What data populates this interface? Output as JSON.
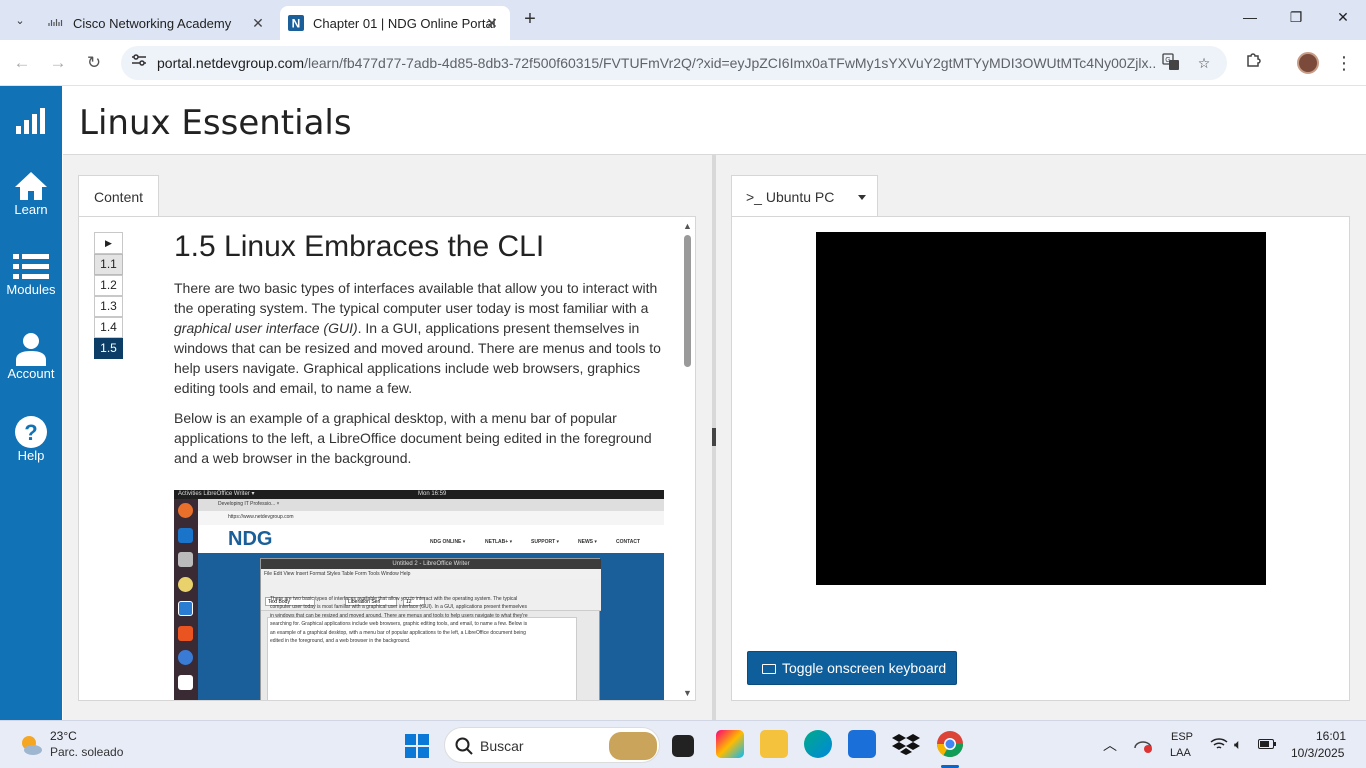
{
  "browser": {
    "tabs": [
      {
        "title": "Cisco Networking Academy"
      },
      {
        "title": "Chapter 01 | NDG Online Portal"
      }
    ],
    "url_host": "portal.netdevgroup.com",
    "url_path": "/learn/fb477d77-7adb-4d85-8db3-72f500f60315/FVTUFmVr2Q/?xid=eyJpZCI6Imx0aTFwMy1sYXVuY2gtMTYyMDI3OWUtMTc4Ny00Zjlx..."
  },
  "sidebar": {
    "items": [
      {
        "label": ""
      },
      {
        "label": "Learn"
      },
      {
        "label": "Modules"
      },
      {
        "label": "Account"
      },
      {
        "label": "Help"
      }
    ]
  },
  "app": {
    "title": "Linux Essentials"
  },
  "content_panel": {
    "tab_label": "Content",
    "toc": [
      "1.1",
      "1.2",
      "1.3",
      "1.4",
      "1.5"
    ],
    "heading": "1.5 Linux Embraces the CLI",
    "para1_a": "There are two basic types of interfaces available that allow you to interact with the operating system. The typical computer user today is most familiar with a ",
    "para1_em": "graphical user interface (GUI)",
    "para1_b": ". In a GUI, applications present themselves in windows that can be resized and moved around. There are menus and tools to help users navigate. Graphical applications include web browsers, graphics editing tools and email, to name a few.",
    "para2": "Below is an example of a graphical desktop, with a menu bar of popular applications to the left, a LibreOffice document being edited in the foreground and a web browser in the background.",
    "figure": {
      "topbar_left": "Activities   LibreOffice Writer ▾",
      "topbar_clock": "Mon 16:59",
      "browser_tab": "Developing IT Professio... ×",
      "browser_url": "https://www.netdevgroup.com",
      "site_logo": "NDG",
      "site_nav": [
        "NDG ONLINE ▾",
        "NETLAB+ ▾",
        "SUPPORT ▾",
        "NEWS ▾",
        "CONTACT"
      ],
      "writer_title": "Untitled 2 - LibreOffice Writer",
      "writer_menu": "File   Edit   View   Insert   Format   Styles   Table   Form   Tools   Window   Help",
      "writer_style": "Text Body",
      "writer_font": "Liberation Seri",
      "writer_size": "12",
      "writer_text": "There are two basic types of interfaces available that allow you to interact with the operating system. The typical computer user today is most familiar with a graphical user interface (GUI). In a GUI, applications present themselves in windows that can be resized and moved around. There are menus and tools to help users navigate to what they're searching for. Graphical applications include web browsers, graphic editing tools, and email, to name a few. Below is an example of a graphical desktop, with a menu bar of popular applications to the left, a LibreOffice document being edited in the foreground, and a web browser in the background."
    }
  },
  "terminal_panel": {
    "tab_label": ">_ Ubuntu PC",
    "keyboard_button": "Toggle onscreen keyboard"
  },
  "taskbar": {
    "temperature": "23°C",
    "weather": "Parc. soleado",
    "search_label": "Buscar",
    "lang": "ESP",
    "layout": "LAA",
    "time": "16:01",
    "date": "10/3/2025"
  }
}
